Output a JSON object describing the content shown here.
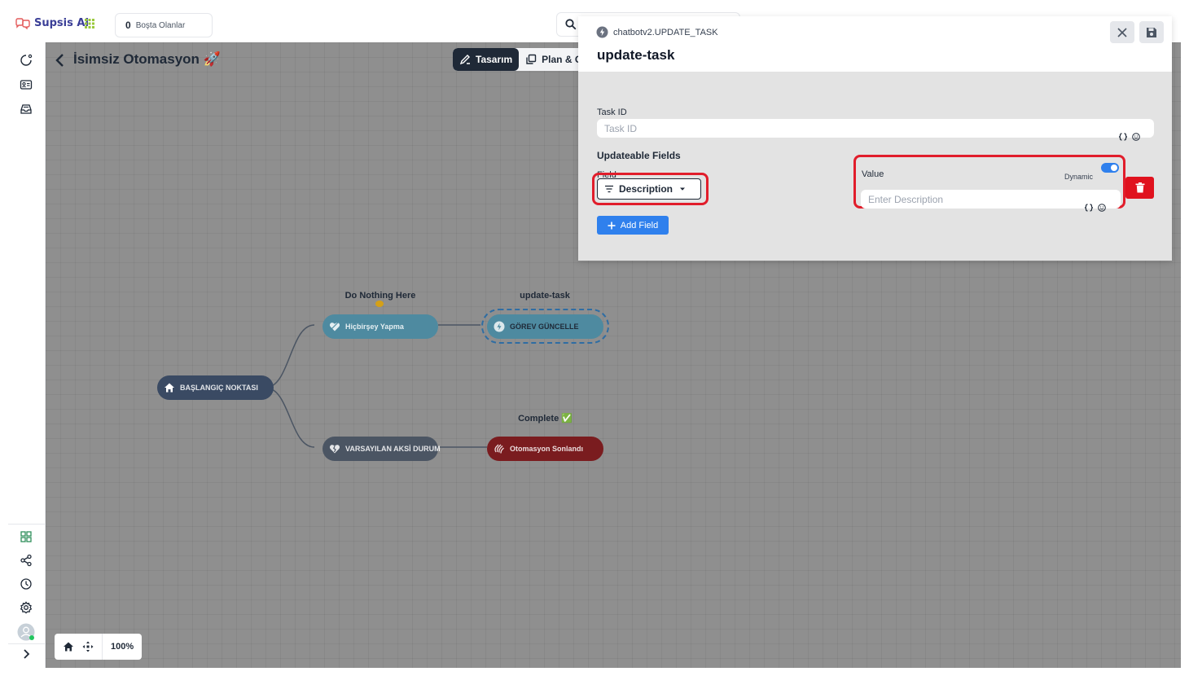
{
  "topbar": {
    "brand": "Supsis Ai",
    "idle_count": "0",
    "idle_label": "Boşta Olanlar"
  },
  "sidebar": {
    "top_icons": [
      "chat-icon",
      "contact-card-icon",
      "inbox-icon"
    ],
    "bottom_icons": [
      "dashboard-grid-icon",
      "share-nodes-icon",
      "history-icon",
      "settings-gear-icon",
      "user-avatar",
      "expand-chevron-icon"
    ]
  },
  "canvas": {
    "title": "İsimsiz Otomasyon 🚀",
    "mode_tabs": [
      {
        "label": "Tasarım",
        "active": true
      },
      {
        "label": "Plan & G",
        "active": false
      }
    ],
    "zoom": "100%",
    "nodes": {
      "start": "BAŞLANGIÇ NOKTASI",
      "do_nothing": "Hiçbirşey Yapma",
      "do_nothing_caption": "Do Nothing Here",
      "update_task": "GÖREV GÜNCELLE",
      "update_task_caption": "update-task",
      "default_case": "VARSAYILAN AKSİ DURUM",
      "end": "Otomasyon Sonlandı",
      "end_caption": "Complete ✅"
    },
    "colors": {
      "start_node": "#3a4a63",
      "action_node": "#4e8aa0",
      "default_node": "#4b5563",
      "end_node": "#7a1c1f"
    }
  },
  "panel": {
    "subtitle": "chatbotv2.UPDATE_TASK",
    "title": "update-task",
    "task_id_label": "Task ID",
    "task_id_placeholder": "Task ID",
    "task_id_value": "",
    "section_title": "Updateable Fields",
    "field_label": "Field",
    "field_value": "Description",
    "value_label": "Value",
    "dynamic_label": "Dynamic",
    "dynamic_enabled": true,
    "value_placeholder": "Enter Description",
    "value_value": "",
    "add_field_label": "Add Field",
    "accent_color": "#2f80ed",
    "danger_color": "#e0121e",
    "highlight_color": "#e11d2b"
  }
}
